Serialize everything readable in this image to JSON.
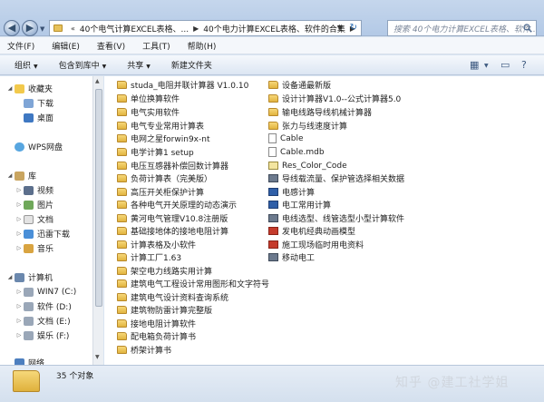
{
  "address": {
    "crumbs": [
      "40个电气计算EXCEL表格、...",
      "40个电力计算EXCEL表格、软件的合集"
    ],
    "search_placeholder": "搜索 40个电力计算EXCEL表格、软件..."
  },
  "menu": [
    "文件(F)",
    "编辑(E)",
    "查看(V)",
    "工具(T)",
    "帮助(H)"
  ],
  "toolbar": {
    "organize": "组织",
    "include": "包含到库中",
    "share": "共享",
    "new_folder": "新建文件夹"
  },
  "nav": {
    "favorites": "收藏夹",
    "downloads": "下载",
    "desktop": "桌面",
    "wps": "WPS网盘",
    "library": "库",
    "videos": "视频",
    "pictures": "图片",
    "documents": "文档",
    "thunder": "迅雷下载",
    "music": "音乐",
    "computer": "计算机",
    "drive_c": "WIN7 (C:)",
    "drive_d": "软件 (D:)",
    "drive_e": "文档 (E:)",
    "drive_f": "娱乐 (F:)",
    "network": "网络"
  },
  "files_col1": [
    "studa_电阻并联计算器 V1.0.10",
    "单位换算软件",
    "电气实用软件",
    "电气专业常用计算表",
    "电网之星forwin9x-nt",
    "电学计算1 setup",
    "电压互感器补偿回数计算器",
    "负荷计算表（完美版）",
    "高压开关柜保护计算",
    "各种电气开关原理的动态演示",
    "黄河电气管理V10.8注册版",
    "基础接地体的接地电阻计算",
    "计算表格及小软件",
    "计算工厂1.63",
    "架空电力线路实用计算",
    "建筑电气工程设计常用图形和文字符号",
    "建筑电气设计资料查询系统",
    "建筑物防雷计算完整版",
    "接地电阻计算软件",
    "配电箱负荷计算书",
    "桥架计算书"
  ],
  "files_col2": [
    "设备通最新版",
    "设计计算器V1.0--公式计算器5.0",
    "输电线路导线机械计算器",
    "张力与线速度计算",
    "Cable",
    "Cable.mdb",
    "Res_Color_Code",
    "导线载流量、保护管选择相关数据",
    "电感计算",
    "电工常用计算",
    "电线选型、线管选型小型计算软件",
    "发电机经典动画模型",
    "施工现场临时用电资料",
    "移动电工"
  ],
  "status": {
    "count": "35 个对象"
  },
  "watermark": "知乎 @建工社学姐"
}
